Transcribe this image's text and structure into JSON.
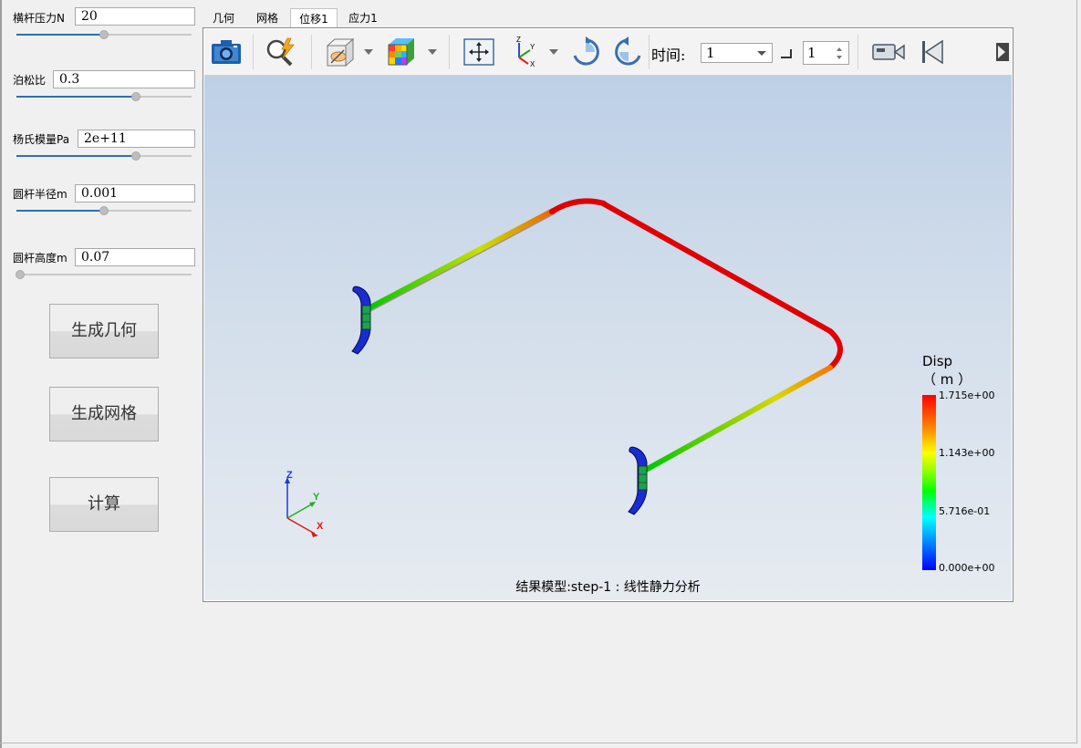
{
  "params": [
    {
      "label": "横杆压力N",
      "value": "20",
      "slider_fraction": 0.5
    },
    {
      "label": "泊松比",
      "value": "0.3",
      "slider_fraction": 0.68
    },
    {
      "label": "杨氏模量Pa",
      "value": "2e+11",
      "slider_fraction": 0.68
    },
    {
      "label": "圆杆半径m",
      "value": "0.001",
      "slider_fraction": 0.5
    },
    {
      "label": "圆杆高度m",
      "value": "0.07",
      "slider_fraction": 0.0
    }
  ],
  "buttons": {
    "gen_geometry": "生成几何",
    "gen_mesh": "生成网格",
    "compute": "计算"
  },
  "tabs": [
    {
      "label": "几何",
      "active": false
    },
    {
      "label": "网格",
      "active": false
    },
    {
      "label": "位移1",
      "active": true
    },
    {
      "label": "应力1",
      "active": false
    }
  ],
  "toolbar": {
    "icons": [
      "camera-icon",
      "zoom-icon",
      "view-box-icon",
      "color-cube-icon",
      "fit-view-icon",
      "axis-orient-icon",
      "rotate-cw-icon",
      "rotate-ccw-icon",
      "record-icon",
      "first-frame-icon",
      "next-frame-icon"
    ],
    "time_label": "时间:",
    "time_value": "1",
    "step_value": "1"
  },
  "viewer": {
    "legend_title": "Disp",
    "legend_unit": "（ m ）",
    "legend_values": [
      "1.715e+00",
      "1.143e+00",
      "5.716e-01",
      "0.000e+00"
    ],
    "axis_labels": {
      "z": "Z",
      "y": "Y",
      "x": "X"
    },
    "status": "结果模型:step-1 : 线性静力分析",
    "background_top": "#bdd0e6",
    "background_bottom": "#e6ebf1"
  }
}
